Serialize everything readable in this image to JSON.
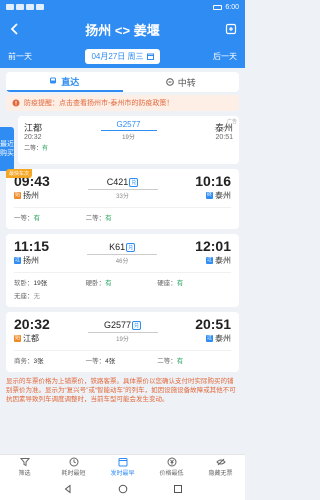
{
  "status_bar": {
    "time": "6:00"
  },
  "header": {
    "title": "扬州 <> 姜堰"
  },
  "date_bar": {
    "prev": "前一天",
    "date": "04月27日 周三",
    "next": "后一天"
  },
  "tabs": [
    {
      "label": "直达",
      "active": true
    },
    {
      "label": "中转",
      "active": false
    }
  ],
  "notice": {
    "text": "防疫提醒：点击查看扬州市-泰州市的防疫政策！"
  },
  "side_tag": {
    "label": "最近购买"
  },
  "ad_card": {
    "from": "江都",
    "from_time": "20:32",
    "train": "G2577",
    "duration": "19分",
    "to": "泰州",
    "to_time": "20:51",
    "seat_label": "二等：",
    "seat_status": "有",
    "corner": "广告"
  },
  "trains": [
    {
      "tag": "最快车次",
      "dep_time": "09:43",
      "dep_station": "扬州",
      "dep_badge": "始",
      "number": "C421",
      "number_tag": "兑",
      "duration": "33分",
      "arr_time": "10:16",
      "arr_station": "泰州",
      "arr_badge": "终",
      "seats": [
        {
          "label": "一等：",
          "value": "有",
          "kind": "ok"
        },
        {
          "label": "二等：",
          "value": "有",
          "kind": "ok"
        }
      ]
    },
    {
      "tag": "",
      "dep_time": "11:15",
      "dep_station": "扬州",
      "dep_badge": "过",
      "number": "K61",
      "number_tag": "兑",
      "duration": "46分",
      "arr_time": "12:01",
      "arr_station": "泰州",
      "arr_badge": "过",
      "seats": [
        {
          "label": "软卧：",
          "value": "19张",
          "kind": "num"
        },
        {
          "label": "硬卧：",
          "value": "有",
          "kind": "ok"
        },
        {
          "label": "硬座：",
          "value": "有",
          "kind": "ok"
        },
        {
          "label": "无座：",
          "value": "无",
          "kind": "none"
        }
      ]
    },
    {
      "tag": "",
      "dep_time": "20:32",
      "dep_station": "江都",
      "dep_badge": "始",
      "number": "G2577",
      "number_tag": "兑",
      "duration": "19分",
      "arr_time": "20:51",
      "arr_station": "泰州",
      "arr_badge": "过",
      "seats": [
        {
          "label": "商务：",
          "value": "3张",
          "kind": "num"
        },
        {
          "label": "一等：",
          "value": "4张",
          "kind": "num"
        },
        {
          "label": "二等：",
          "value": "有",
          "kind": "ok"
        }
      ]
    }
  ],
  "disclaimer": "显示的车票价格为上铺票价，铁路客票。具体票价以您确认支付时实际购买的铺别票价为准。显示为“复兴号”或“智能动车”的列车，如因设施设备故障或其他不可抗因素导致列车调度调整时，当前车型可能会发生变动。",
  "bottom_nav": [
    {
      "label": "筛选",
      "icon": "filter-icon",
      "active": false
    },
    {
      "label": "耗时最短",
      "icon": "clock-icon",
      "active": false
    },
    {
      "label": "发时最早",
      "icon": "calendar-icon",
      "active": true
    },
    {
      "label": "价格最低",
      "icon": "yen-icon",
      "active": false
    },
    {
      "label": "隐藏无票",
      "icon": "eye-off-icon",
      "active": false
    }
  ],
  "colors": {
    "primary": "#2f8cf2",
    "available": "#26a65b",
    "warning": "#e2683a"
  }
}
